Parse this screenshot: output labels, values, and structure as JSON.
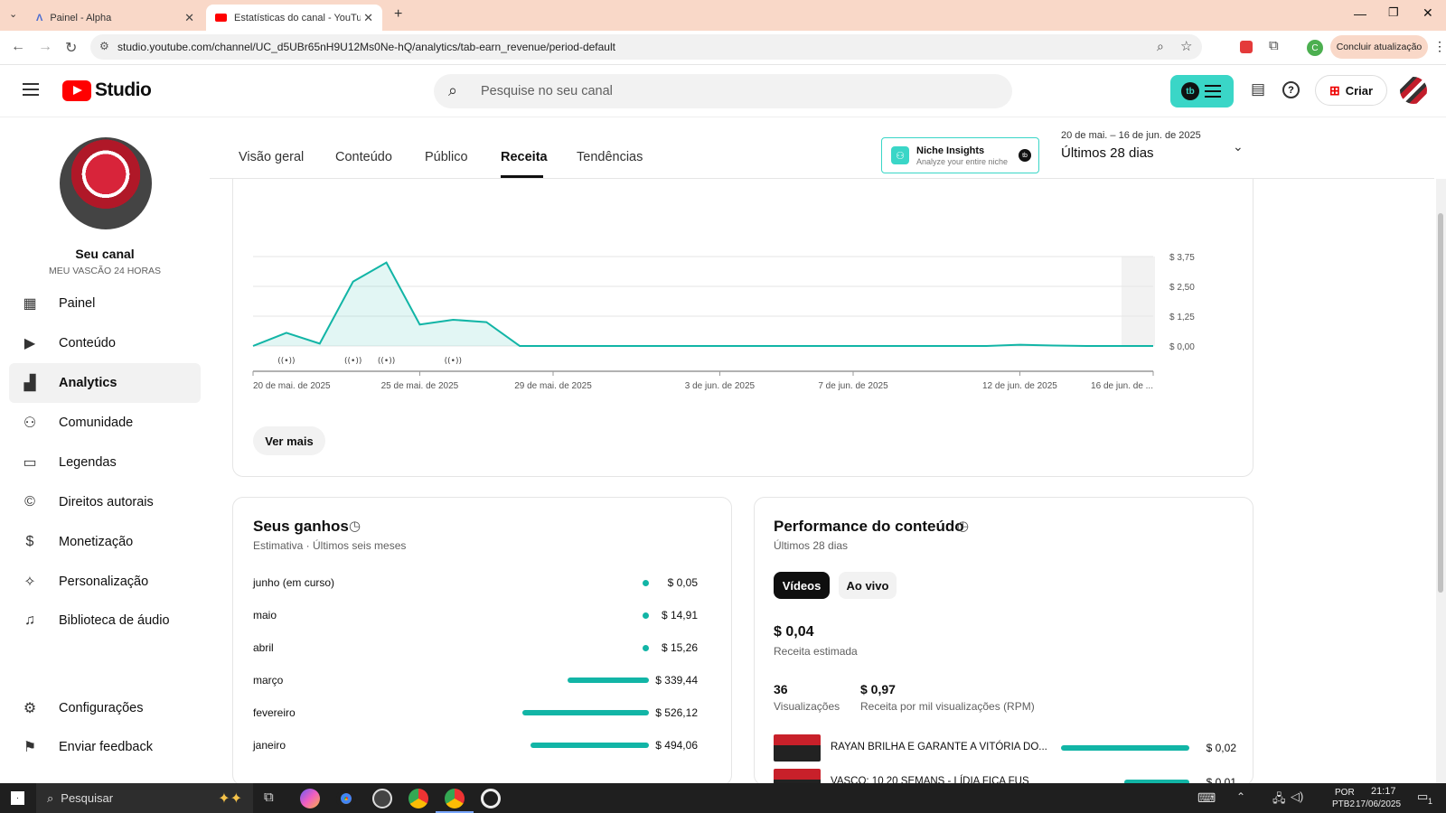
{
  "browser": {
    "tabs": [
      {
        "title": "Painel - Alpha"
      },
      {
        "title": "Estatísticas do canal - YouTube"
      }
    ],
    "url": "studio.youtube.com/channel/UC_d5UBr65nH9U12Ms0Ne-hQ/analytics/tab-earn_revenue/period-default",
    "update_label": "Concluir atualização",
    "profile_initial": "C"
  },
  "header": {
    "brand": "Studio",
    "search_placeholder": "Pesquise no seu canal",
    "create_label": "Criar"
  },
  "channel": {
    "title": "Seu canal",
    "name": "MEU VASCÃO 24 HORAS"
  },
  "sidebar": {
    "items": [
      {
        "label": "Painel",
        "icon": "dashboard-icon"
      },
      {
        "label": "Conteúdo",
        "icon": "content-icon"
      },
      {
        "label": "Analytics",
        "icon": "analytics-icon",
        "active": true
      },
      {
        "label": "Comunidade",
        "icon": "community-icon"
      },
      {
        "label": "Legendas",
        "icon": "subtitles-icon"
      },
      {
        "label": "Direitos autorais",
        "icon": "copyright-icon"
      },
      {
        "label": "Monetização",
        "icon": "dollar-icon"
      },
      {
        "label": "Personalização",
        "icon": "magic-wand-icon"
      },
      {
        "label": "Biblioteca de áudio",
        "icon": "audio-library-icon"
      }
    ],
    "bottom": [
      {
        "label": "Configurações",
        "icon": "gear-icon"
      },
      {
        "label": "Enviar feedback",
        "icon": "feedback-icon"
      }
    ]
  },
  "analytics_tabs": [
    "Visão geral",
    "Conteúdo",
    "Público",
    "Receita",
    "Tendências"
  ],
  "niche": {
    "title": "Niche Insights",
    "subtitle": "Analyze your entire niche"
  },
  "period": {
    "range": "20 de mai. – 16 de jun. de 2025",
    "label": "Últimos 28 dias"
  },
  "chart_data": {
    "type": "area",
    "x": [
      "20 de mai. de 2025",
      "21 de mai.",
      "22 de mai.",
      "23 de mai.",
      "24 de mai.",
      "25 de mai.",
      "26 de mai.",
      "27 de mai.",
      "28 de mai.",
      "29 de mai. de 2025",
      "30 de mai.",
      "31 de mai.",
      "1 de jun.",
      "2 de jun.",
      "3 de jun. de 2025",
      "4 de jun.",
      "5 de jun.",
      "6 de jun.",
      "7 de jun. de 2025",
      "8 de jun.",
      "9 de jun.",
      "10 de jun.",
      "11 de jun.",
      "12 de jun. de 2025",
      "13 de jun.",
      "14 de jun.",
      "15 de jun.",
      "16 de jun. de 2025"
    ],
    "y": [
      0.0,
      0.55,
      0.1,
      2.7,
      3.5,
      0.9,
      1.1,
      1.0,
      0.0,
      0.0,
      0.0,
      0.0,
      0.0,
      0.0,
      0.0,
      0.0,
      0.0,
      0.0,
      0.0,
      0.0,
      0.0,
      0.0,
      0.0,
      0.05,
      0.02,
      0.0,
      0.0,
      0.0
    ],
    "x_tick_labels": [
      "20 de mai. de 2025",
      "25 de mai. de 2025",
      "29 de mai. de 2025",
      "3 de jun. de 2025",
      "7 de jun. de 2025",
      "12 de jun. de 2025",
      "16 de jun. de ..."
    ],
    "y_tick_labels": [
      "$ 3,75",
      "$ 2,50",
      "$ 1,25",
      "$ 0,00"
    ],
    "ylim": [
      0,
      3.75
    ],
    "live_markers": [
      1,
      3,
      4,
      6
    ],
    "color": "#12b5a6",
    "grid": true
  },
  "ver_mais": "Ver mais",
  "earnings": {
    "title": "Seus ganhos",
    "subtitle": "Estimativa · Últimos seis meses",
    "rows": [
      {
        "month": "junho (em curso)",
        "value": "$ 0,05",
        "amount": 0.05
      },
      {
        "month": "maio",
        "value": "$ 14,91",
        "amount": 14.91
      },
      {
        "month": "abril",
        "value": "$ 15,26",
        "amount": 15.26
      },
      {
        "month": "março",
        "value": "$ 339,44",
        "amount": 339.44
      },
      {
        "month": "fevereiro",
        "value": "$ 526,12",
        "amount": 526.12
      },
      {
        "month": "janeiro",
        "value": "$ 494,06",
        "amount": 494.06
      }
    ]
  },
  "performance": {
    "title": "Performance do conteúdo",
    "subtitle": "Últimos 28 dias",
    "tabs": [
      "Vídeos",
      "Ao vivo"
    ],
    "revenue": "$ 0,04",
    "revenue_label": "Receita estimada",
    "views": "36",
    "views_label": "Visualizações",
    "rpm": "$ 0,97",
    "rpm_label": "Receita por mil visualizações (RPM)",
    "videos": [
      {
        "title": "RAYAN BRILHA E GARANTE A VITÓRIA DO...",
        "value": "$ 0,02"
      },
      {
        "title": "VASCO: 10 20 SEMANS - LÍDIA FICA FUS",
        "value": "$ 0,01"
      }
    ]
  },
  "taskbar": {
    "search_placeholder": "Pesquisar",
    "lang": "POR",
    "layout": "PTB2",
    "time": "21:17",
    "date": "17/06/2025",
    "notif_count": "1"
  }
}
